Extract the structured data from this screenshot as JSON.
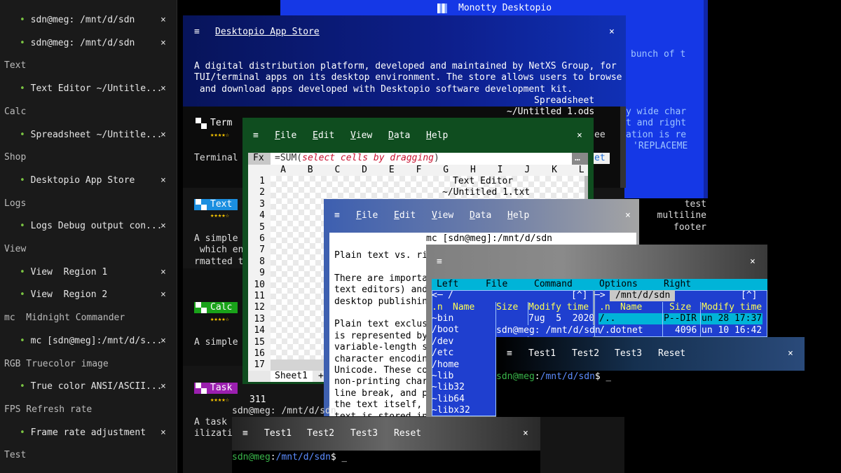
{
  "sidebar": {
    "rows": [
      {
        "kind": "item",
        "label": "sdn@meg: /mnt/d/sdn"
      },
      {
        "kind": "item",
        "label": "sdn@meg: /mnt/d/sdn"
      },
      {
        "kind": "head",
        "label": "Text"
      },
      {
        "kind": "item",
        "label": "Text Editor ~/Untitle..."
      },
      {
        "kind": "head",
        "label": "Calc"
      },
      {
        "kind": "item",
        "label": "Spreadsheet ~/Untitle..."
      },
      {
        "kind": "head",
        "label": "Shop"
      },
      {
        "kind": "item",
        "label": "Desktopio App Store"
      },
      {
        "kind": "head",
        "label": "Logs"
      },
      {
        "kind": "item",
        "label": "Logs Debug output con..."
      },
      {
        "kind": "head",
        "label": "View"
      },
      {
        "kind": "item",
        "label": "View  Region 1"
      },
      {
        "kind": "item",
        "label": "View  Region 2"
      },
      {
        "kind": "head",
        "label": "mc  Midnight Commander"
      },
      {
        "kind": "item",
        "label": "mc [sdn@meg]:/mnt/d/s..."
      },
      {
        "kind": "head",
        "label": "RGB Truecolor image"
      },
      {
        "kind": "item",
        "label": "True color ANSI/ASCII..."
      },
      {
        "kind": "head",
        "label": "FPS Refresh rate"
      },
      {
        "kind": "item",
        "label": "Frame rate adjustment"
      },
      {
        "kind": "head",
        "label": "Test"
      }
    ],
    "close_glyph": "×",
    "bullet": "•"
  },
  "desktopio": {
    "title": "Monotty Desktopio",
    "fragments": [
      "bunch of t",
      "y wide char",
      "t and right",
      "ation is re",
      "'REPLACEME"
    ]
  },
  "store": {
    "title": "Desktopio App Store",
    "hamburger": "≡",
    "close": "×",
    "description": [
      "A digital distribution platform, developed and maintained by NetXS Group, for",
      "TUI/terminal apps on its desktop environment. The store allows users to browse",
      " and download apps developed with Desktopio software development kit."
    ],
    "sheet_title": "Spreadsheet",
    "sheet_path": "~/Untitled 1.ods",
    "apps": [
      {
        "name": "Term",
        "stars": "★★★★☆",
        "desc": "Terminal"
      },
      {
        "name": "Text",
        "stars": "★★★★☆",
        "desc1": "A simple",
        "desc2": " which en",
        "desc3": "rmatted t"
      },
      {
        "name": "Calc",
        "stars": "★★★★☆",
        "desc": "A simple"
      },
      {
        "name": "Task",
        "stars": "★★★★☆",
        "count": "311",
        "desc1": "A task",
        "desc2": "ilizati"
      }
    ],
    "right_frag": "ee",
    "right_btn": "et",
    "footer": [
      "test",
      "multiline",
      "footer"
    ]
  },
  "calc": {
    "menu": [
      "File",
      "Edit",
      "View",
      "Data",
      "Help"
    ],
    "fx": "Fx",
    "formula_prefix": "=SUM(",
    "formula_hint": "select cells by dragging",
    "formula_suffix": ")",
    "more": "…",
    "columns": [
      "A",
      "B",
      "C",
      "D",
      "E",
      "F",
      "G",
      "H",
      "I",
      "J",
      "K",
      "L"
    ],
    "rows": [
      "1",
      "2",
      "3",
      "4",
      "5",
      "6",
      "7",
      "8",
      "9",
      "10",
      "11",
      "12",
      "13",
      "14",
      "15",
      "16",
      "17"
    ],
    "sheet_tab": "Sheet1",
    "add_tab": "+",
    "text_editor_title": "Text Editor",
    "text_editor_path": "~/Untitled 1.txt"
  },
  "editor": {
    "menu": [
      "File",
      "Edit",
      "View",
      "Data",
      "Help"
    ],
    "mc_title": "mc [sdn@meg]:/mnt/d/sdn",
    "lines": [
      "Plain text vs. ri",
      "",
      "There are importa",
      "text editors) and",
      "desktop publishin",
      "",
      "Plain text exclus",
      "is represented by",
      "variable-length s",
      "character encodin",
      "Unicode. These co",
      "non-printing char",
      "line break, and p",
      "the text itself, ",
      "text is stored in"
    ],
    "prompt": "sdn@meg: /mnt/d/sdn"
  },
  "mc": {
    "menu": [
      "Left",
      "File",
      "Command",
      "Options",
      "Right"
    ],
    "left_path": "/",
    "left_hdr": [
      ".n",
      "Name",
      "Size",
      "Modify time"
    ],
    "left_rows": [
      {
        "name": "~bin",
        "size": "7",
        "time": "ug  5  2020"
      },
      {
        "name": "/boot"
      },
      {
        "name": "/dev"
      },
      {
        "name": "/etc"
      },
      {
        "name": "/home"
      },
      {
        "name": "~lib"
      },
      {
        "name": "~lib32"
      },
      {
        "name": "~lib64"
      },
      {
        "name": "~libx32"
      }
    ],
    "right_path": "/mnt/d/sdn",
    "right_hdr": [
      ".n",
      "Name",
      "Size",
      "Modify time"
    ],
    "right_rows": [
      {
        "name": "/..",
        "size": "P--DIR",
        "time": "un 28 17:37"
      },
      {
        "name": "/.dotnet",
        "size": "4096",
        "time": "un 10 16:42"
      }
    ],
    "right_prompt": "sdn@meg: /mnt/d/sdn",
    "up": "[^]",
    "left_corner": "<─",
    "right_corner": "─>"
  },
  "term1": {
    "tabs": [
      "Test1",
      "Test2",
      "Test3",
      "Reset"
    ],
    "user": "sdn@meg",
    "path": "/mnt/d/sdn",
    "sign": "$ _"
  },
  "term2": {
    "tabs": [
      "Test1",
      "Test2",
      "Test3",
      "Reset"
    ],
    "user": "sdn@meg",
    "path": "/mnt/d/sdn",
    "sign": "$ _"
  },
  "colors": {
    "sidebar_bg": "#1a1a1a",
    "store_bg": "#0a1a7a",
    "calc_green": "#0f4d1f",
    "mc_blue": "#1f3fcf",
    "mc_cyan": "#00b4d8",
    "prompt_green": "#39b54a",
    "prompt_blue": "#5d8dff"
  }
}
